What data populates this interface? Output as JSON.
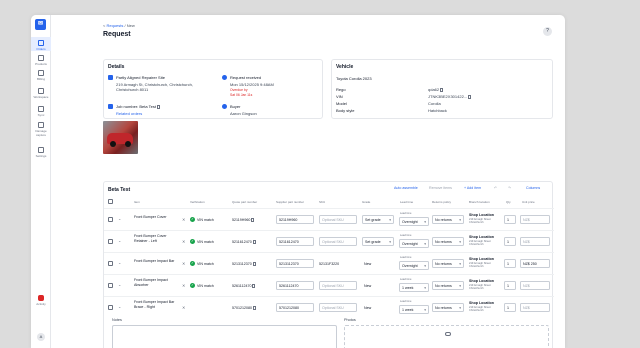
{
  "rail": {
    "logo": "✉",
    "items": [
      {
        "label": "Orders",
        "icon": "orders-icon"
      },
      {
        "label": "Products",
        "icon": "tag-icon"
      },
      {
        "label": "Billing",
        "icon": "billing-icon"
      },
      {
        "label": "Workspace",
        "icon": "workspace-icon"
      },
      {
        "label": "Sync",
        "icon": "sync-icon"
      },
      {
        "label": "Damage capture",
        "icon": "camera-icon"
      },
      {
        "label": "Settings",
        "icon": "gear-icon"
      }
    ],
    "activity": "Activity",
    "avatar": "A"
  },
  "header": {
    "breadcrumb_back": "<",
    "breadcrumb": "Requests",
    "breadcrumb_sep": "/",
    "breadcrumb_current": "New",
    "title": "Request",
    "help": "?"
  },
  "details": {
    "heading": "Details",
    "repairer_name": "Partly Aligned Repairer Site",
    "repairer_address1": "219 Armagh St, Christchurch, Christchurch,",
    "repairer_address2": "Christchurch 8011",
    "request_label": "Request received",
    "request_date": "Mon 15/12/2025 9:48AM",
    "overdue": "Overdue by",
    "overdue_since": "Sat 06 Jan 11s",
    "job_label": "Job number: Beta Test",
    "related": "Related orders",
    "buyer_label": "Buyer",
    "buyer_name": "Aaron Gingson"
  },
  "vehicle": {
    "heading": "Vehicle",
    "name": "Toyota Corolla 2023",
    "rows": [
      {
        "label": "Rego",
        "value": "qda62"
      },
      {
        "label": "VIN",
        "value": "JTNK3BE2X301422..."
      },
      {
        "label": "Model",
        "value": "Corolla"
      },
      {
        "label": "Body style",
        "value": "Hatchback"
      }
    ]
  },
  "table": {
    "title": "Beta Test",
    "toolbar": {
      "auto_assemble": "Auto assemble",
      "remove_items": "Remove items",
      "add_item": "+ Add item",
      "columns": "Columns"
    },
    "headers": [
      "Item",
      "Verification",
      "Quote part number",
      "Supplier part number",
      "SKU",
      "Grade",
      "Lead time",
      "Returns policy",
      "Branch location",
      "Qty",
      "Unit price"
    ],
    "rows": [
      {
        "name": "Front Bumper Cover",
        "verify": "VIN match",
        "quote_pn": "52119H960",
        "supplier_pn": "52119H960",
        "sku": "Optional SKU",
        "grade": "Set grade",
        "lead_label": "Lead time",
        "lead": "Overnight",
        "returns": "No returns",
        "branch": "Shop Location",
        "branch_addr": "219 Armagh Street Christchurch",
        "qty": "1",
        "price": "NZ$"
      },
      {
        "name": "Front Bumper Cover Retainer - Left",
        "verify": "VIN match",
        "quote_pn": "5211612470",
        "supplier_pn": "5211612470",
        "sku": "Optional SKU",
        "grade": "Set grade",
        "lead_label": "Lead time",
        "lead": "Overnight",
        "returns": "No returns",
        "branch": "Shop Location",
        "branch_addr": "219 Armagh Street Christchurch",
        "qty": "1",
        "price": "NZ$"
      },
      {
        "name": "Front Bumper Impact Bar",
        "verify": "VIN match",
        "quote_pn": "5213112370",
        "supplier_pn": "5213112370",
        "sku": "52131F3220",
        "grade": "New",
        "lead_label": "Lead time",
        "lead": "Overnight",
        "returns": "No returns",
        "branch": "Shop Location",
        "branch_addr": "219 Armagh Street Christchurch",
        "qty": "1",
        "price": "NZ$ 250"
      },
      {
        "name": "Front Bumper Impact Absorber",
        "verify": "VIN match",
        "quote_pn": "5261112470",
        "supplier_pn": "5261112470",
        "sku": "Optional SKU",
        "grade": "New",
        "lead_label": "Lead time",
        "lead": "1 week",
        "returns": "No returns",
        "branch": "Shop Location",
        "branch_addr": "219 Armagh Street Christchurch",
        "qty": "1",
        "price": "NZ$"
      },
      {
        "name": "Front Bumper Impact Bar Brace - Right",
        "verify": "",
        "quote_pn": "5701212080",
        "supplier_pn": "5701212080",
        "sku": "Optional SKU",
        "grade": "New",
        "lead_label": "Lead time",
        "lead": "1 week",
        "returns": "No returns",
        "branch": "Shop Location",
        "branch_addr": "219 Armagh Street Christchurch",
        "qty": "1",
        "price": "NZ$"
      }
    ],
    "notes": "Notes",
    "photos": "Photos"
  },
  "colors": {
    "accent": "#2563eb",
    "success": "#16a34a",
    "danger": "#dc2626"
  }
}
